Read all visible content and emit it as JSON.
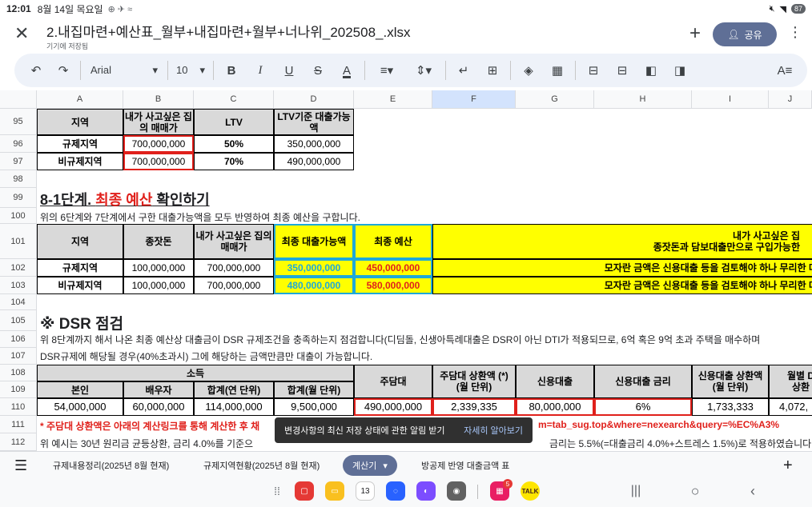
{
  "status": {
    "time": "12:01",
    "date": "8월 14일 목요일",
    "icons": "⊕ ✈ ≈",
    "battery": "87"
  },
  "header": {
    "title": "2.내집마련+예산표_월부+내집마련+월부+너나위_202508_.xlsx",
    "subtitle": "기기에 저장됨",
    "share_label": "공유"
  },
  "toolbar": {
    "font": "Arial",
    "size": "10"
  },
  "columns": [
    "A",
    "B",
    "C",
    "D",
    "E",
    "F",
    "G",
    "H",
    "I",
    "J"
  ],
  "rows": [
    "95",
    "96",
    "97",
    "98",
    "99",
    "100",
    "101",
    "102",
    "103",
    "104",
    "105",
    "106",
    "107",
    "108",
    "109",
    "110",
    "111",
    "112"
  ],
  "t1": {
    "h_region": "지역",
    "h_price": "내가 사고싶은 집의 매매가",
    "h_ltv": "LTV",
    "h_loan": "LTV기준 대출가능액",
    "r1": {
      "region": "규제지역",
      "price": "700,000,000",
      "ltv": "50%",
      "loan": "350,000,000"
    },
    "r2": {
      "region": "비규제지역",
      "price": "700,000,000",
      "ltv": "70%",
      "loan": "490,000,000"
    }
  },
  "sec81": {
    "prefix": "8-1단계. ",
    "highlight": "최종 예산",
    "suffix": " 확인하기",
    "desc": "위의 6단계와 7단계에서 구한 대출가능액을 모두 반영하여 최종 예산을 구합니다."
  },
  "t2": {
    "h_region": "지역",
    "h_seed": "종잣돈",
    "h_price": "내가 사고싶은 집의 매매가",
    "h_final_loan": "최종 대출가능액",
    "h_budget": "최종 예산",
    "h_yellow1": "내가 사고싶은 집",
    "h_yellow2": "종잣돈과 담보대출만으로 구입가능한",
    "r1": {
      "region": "규제지역",
      "seed": "100,000,000",
      "price": "700,000,000",
      "loan": "350,000,000",
      "budget": "450,000,000",
      "note": "모자란 금액은 신용대출 등을 검토해야 하나 무리한 대"
    },
    "r2": {
      "region": "비규제지역",
      "seed": "100,000,000",
      "price": "700,000,000",
      "loan": "480,000,000",
      "budget": "580,000,000",
      "note": "모자란 금액은 신용대출 등을 검토해야 하나 무리한 대"
    }
  },
  "dsr": {
    "title": "※ DSR 점검",
    "desc1": "위 8단계까지 해서 나온 최종 예산상 대출금이 DSR 규제조건을 충족하는지 점검합니다(디딤돌, 신생아특례대출은 DSR이 아닌 DTI가 적용되므로, 6억 혹은 9억 초과 주택을 매수하며",
    "desc2": "DSR규제에 해당될 경우(40%초과시) 그에 해당하는 금액만큼만 대출이 가능합니다."
  },
  "t3": {
    "h_income": "소득",
    "h_self": "본인",
    "h_spouse": "배우자",
    "h_year": "합계(연 단위)",
    "h_month": "합계(월 단위)",
    "h_mortgage": "주담대",
    "h_mort_repay": "주담대 상환액 (*)\n(월 단위)",
    "h_credit": "신용대출",
    "h_credit_rate": "신용대출 금리",
    "h_credit_repay": "신용대출 상환액\n(월 단위)",
    "h_monthly": "월별 D\n상환",
    "v_self": "54,000,000",
    "v_spouse": "60,000,000",
    "v_year": "114,000,000",
    "v_month": "9,500,000",
    "v_mortgage": "490,000,000",
    "v_mort_repay": "2,339,335",
    "v_credit": "80,000,000",
    "v_rate": "6%",
    "v_credit_repay": "1,733,333",
    "v_monthly": "4,072,"
  },
  "row111": {
    "left": "* 주담대 상환액은 아래의 계산링크를 통해 계산한 후 채",
    "right": "m=tab_sug.top&where=nexearch&query=%EC%A3%"
  },
  "row112": {
    "left": "위 예시는 30년 원리금 균등상환, 금리 4.0%를 기준으",
    "right": "금리는 5.5%(=대출금리 4.0%+스트레스 1.5%)로 적용하였습니다"
  },
  "snackbar": {
    "text": "변경사항의 최신 저장 상태에 관한 알림 받기",
    "action": "자세히 알아보기"
  },
  "tabs": {
    "t1": "규제내용정리(2025년 8월 현재)",
    "t2": "규제지역현황(2025년 8월 현재)",
    "t3": "계산기",
    "t4": "방공제 반영 대출금액 표"
  },
  "dock": {
    "calendar_day": "13",
    "badge": "5",
    "kakao": "TALK"
  },
  "colors": {
    "accent": "#5f6f96",
    "red": "#e0201b",
    "blue": "#1fa9d8",
    "yellow": "#ffff00"
  }
}
